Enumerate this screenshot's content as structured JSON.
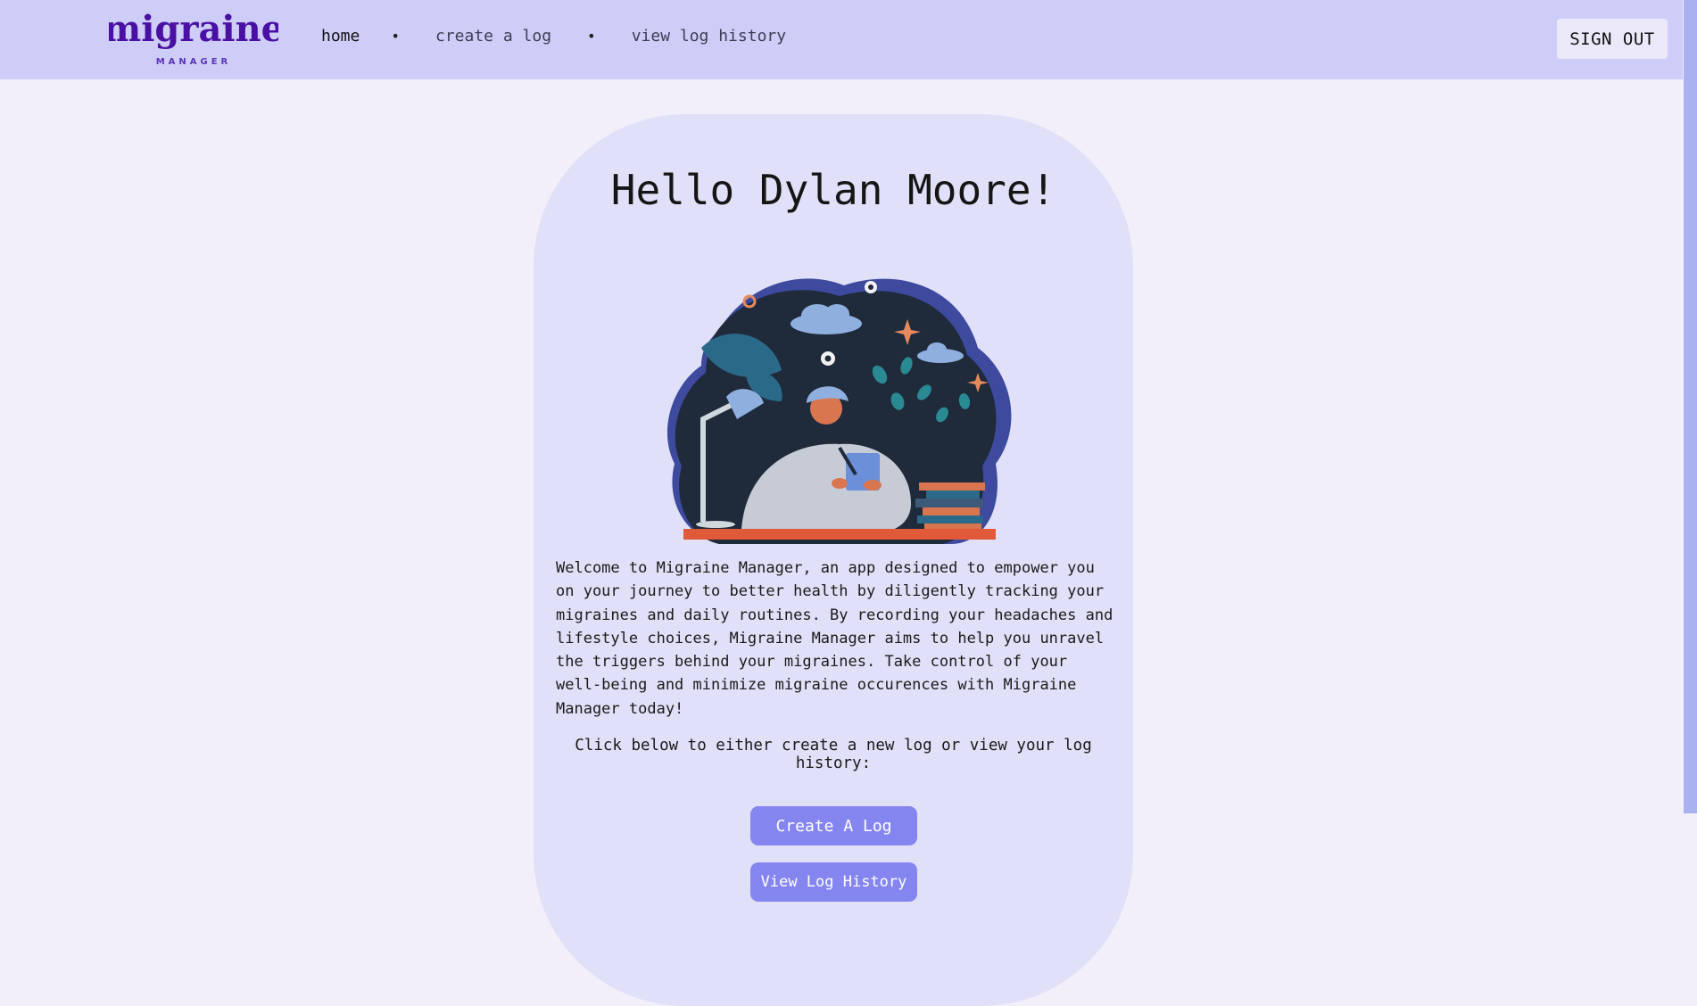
{
  "brand": {
    "name": "migraine",
    "tagline": "MANAGER"
  },
  "nav": {
    "items": [
      {
        "label": "home",
        "active": true
      },
      {
        "label": "create a log",
        "active": false
      },
      {
        "label": "view log history",
        "active": false
      }
    ],
    "separator": "•",
    "signout_label": "SIGN OUT"
  },
  "main": {
    "greeting": "Hello Dylan Moore!",
    "intro": "Welcome to Migraine Manager, an app designed to empower you on your journey to better health by diligently tracking your migraines and daily routines. By recording your headaches and lifestyle choices, Migraine Manager aims to help you unravel the triggers behind your migraines. Take control of your well-being and minimize migraine occurences with Migraine Manager today!",
    "instruction": "Click below to either create a new log or view your log history:",
    "create_button": "Create A Log",
    "history_button": "View Log History"
  },
  "colors": {
    "navbar": "#cecdf7",
    "page_bg": "#f2effa",
    "card_bg": "#e0e0f8",
    "button": "#8585f0",
    "brand_purple": "#4a0fa3"
  }
}
